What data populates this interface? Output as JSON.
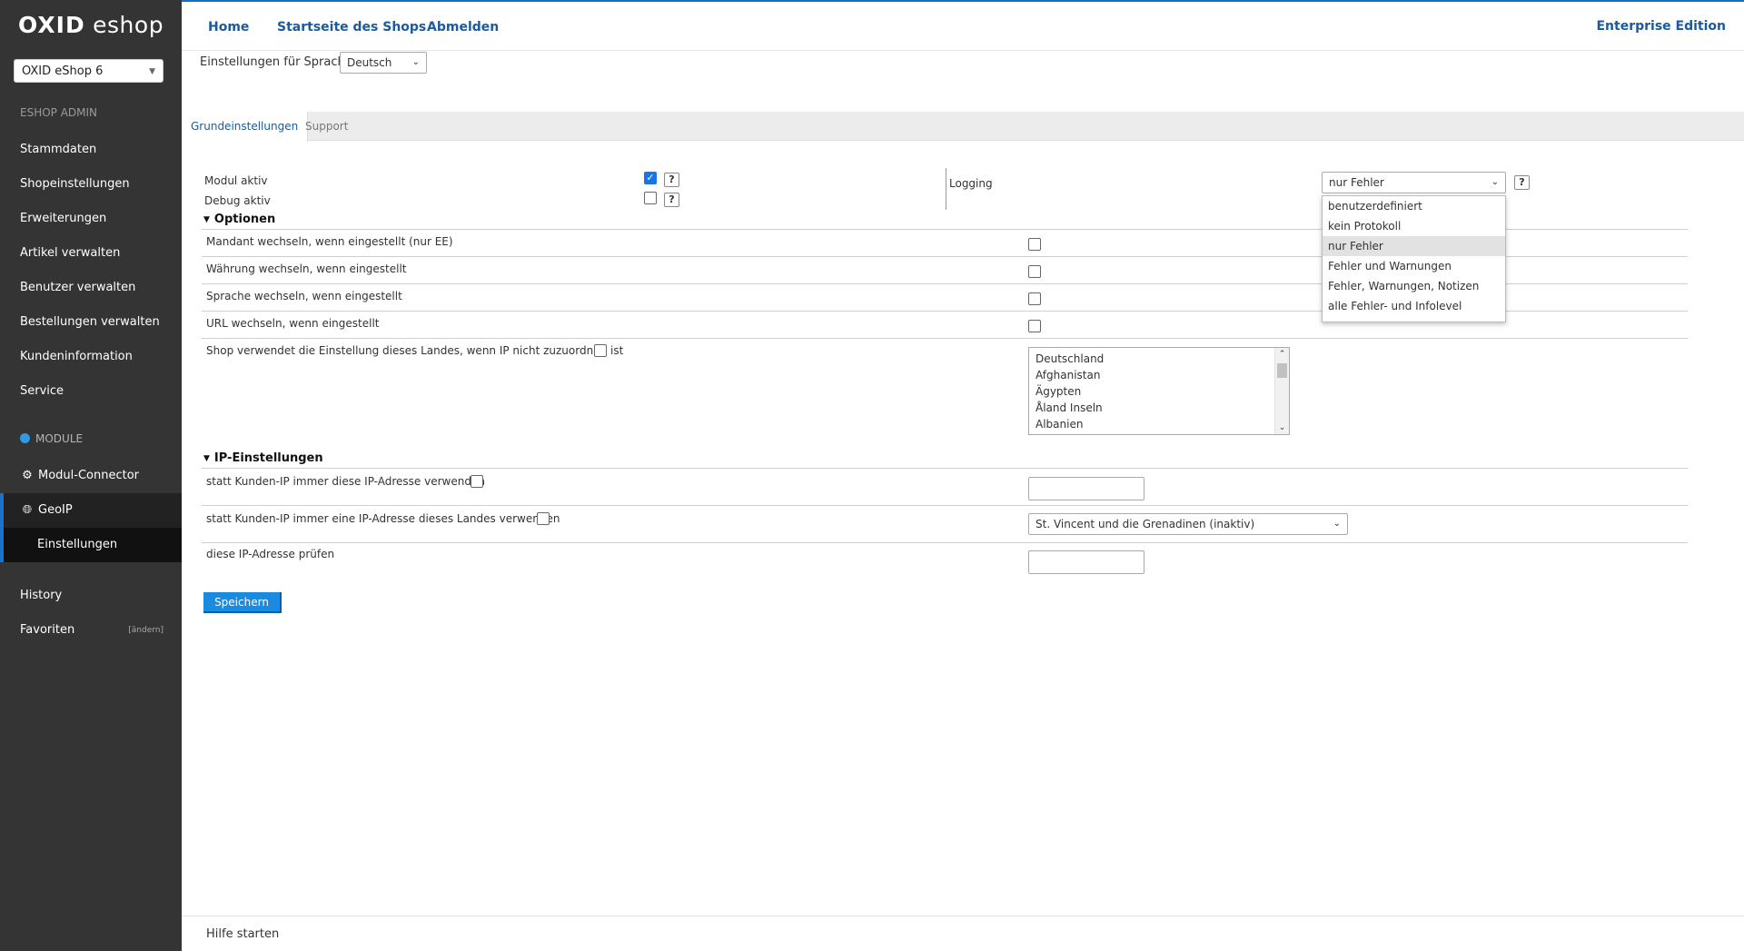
{
  "brand": {
    "logo_bold": "OXID",
    "logo_rest": " eshop"
  },
  "sidebar": {
    "shop_select": "OXID eShop 6",
    "admin_head": "ESHOP ADMIN",
    "items": [
      "Stammdaten",
      "Shopeinstellungen",
      "Erweiterungen",
      "Artikel verwalten",
      "Benutzer verwalten",
      "Bestellungen verwalten",
      "Kundeninformation",
      "Service"
    ],
    "module_head": "MODULE",
    "module_connector": "Modul-Connector",
    "geoip": "GeoIP",
    "geoip_sub": "Einstellungen",
    "history": "History",
    "favoriten": "Favoriten",
    "favoriten_edit": "[ändern]"
  },
  "topbar": {
    "home": "Home",
    "startseite": "Startseite des Shops",
    "abmelden": "Abmelden",
    "edition": "Enterprise Edition"
  },
  "language": {
    "label": "Einstellungen für Sprache",
    "selected": "Deutsch"
  },
  "tabs": [
    "Grundeinstellungen",
    "Support"
  ],
  "form": {
    "modul_aktiv": "Modul aktiv",
    "debug_aktiv": "Debug aktiv",
    "help": "?",
    "logging_label": "Logging",
    "logging_selected": "nur Fehler",
    "logging_options": [
      "benutzerdefiniert",
      "kein Protokoll",
      "nur Fehler",
      "Fehler und Warnungen",
      "Fehler, Warnungen, Notizen",
      "alle Fehler- und Infolevel"
    ],
    "optionen": "Optionen",
    "opt_rows": [
      "Mandant wechseln, wenn eingestellt (nur EE)",
      "Währung wechseln, wenn eingestellt",
      "Sprache wechseln, wenn eingestellt",
      "URL wechseln, wenn eingestellt"
    ],
    "country_label": "Shop verwendet die Einstellung dieses Landes, wenn IP nicht zuzuordnen ist",
    "countries": [
      "Deutschland",
      "Afghanistan",
      "Ägypten",
      "Åland Inseln",
      "Albanien"
    ],
    "ip_section": "IP-Einstellungen",
    "ip_row1": "statt Kunden-IP immer diese IP-Adresse verwenden",
    "ip_row2": "statt Kunden-IP immer eine IP-Adresse dieses Landes verwenden",
    "ip_row2_select": "St. Vincent und die Grenadinen (inaktiv)",
    "ip_row3": "diese IP-Adresse prüfen",
    "save": "Speichern"
  },
  "footer": {
    "help": "Hilfe starten"
  }
}
